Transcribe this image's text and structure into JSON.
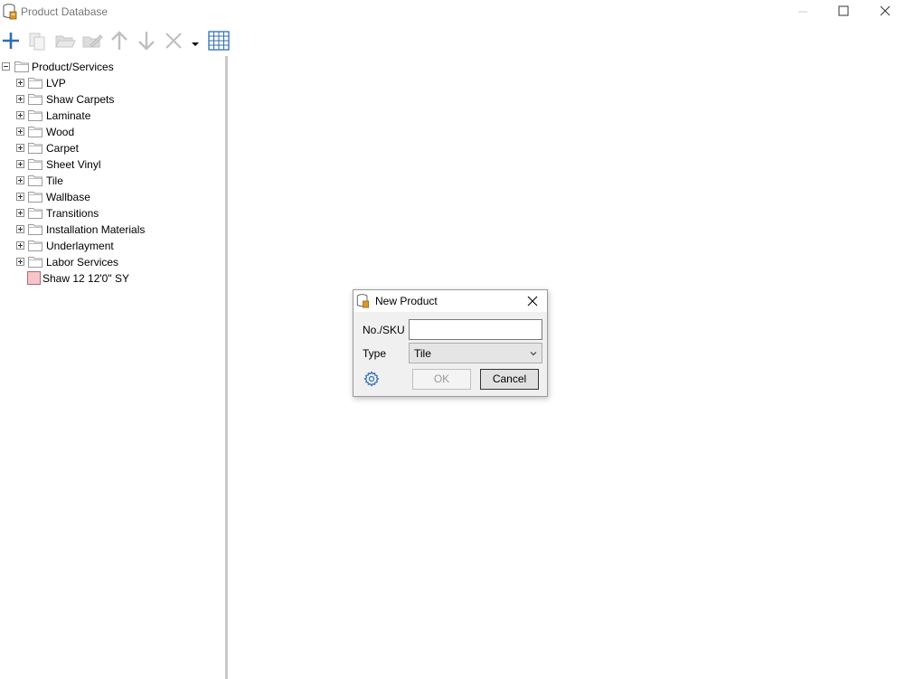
{
  "window": {
    "title": "Product Database"
  },
  "toolbar": {
    "icons": [
      "add-icon",
      "copy-icon",
      "open-folder-icon",
      "edit-icon",
      "move-up-icon",
      "move-down-icon",
      "delete-icon",
      "dropdown-arrow-icon",
      "grid-icon"
    ]
  },
  "tree": {
    "root": "Product/Services",
    "folders": [
      "LVP",
      "Shaw Carpets",
      "Laminate",
      "Wood",
      "Carpet",
      "Sheet Vinyl",
      "Tile",
      "Wallbase",
      "Transitions",
      "Installation Materials",
      "Underlayment",
      "Labor Services"
    ],
    "item": "Shaw 12 12'0\" SY",
    "item_color": "#f6c5c9"
  },
  "dialog": {
    "title": "New Product",
    "sku_label": "No./SKU",
    "sku_value": "",
    "type_label": "Type",
    "type_value": "Tile",
    "ok_label": "OK",
    "cancel_label": "Cancel"
  },
  "colors": {
    "accent": "#2f6db3",
    "disabled": "#b9b9b9"
  }
}
